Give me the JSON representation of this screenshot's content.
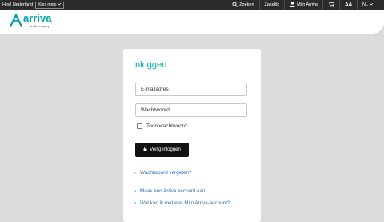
{
  "topbar": {
    "region_label": "Heel Nederland",
    "region_button": "Kies regio",
    "search_label": "Zoeken",
    "business_label": "Zakelijk",
    "account_label": "Mijn Arriva",
    "text_size_label": "AA",
    "language_label": "NL"
  },
  "header": {
    "logo_text": "arriva",
    "logo_sub": "a DB company"
  },
  "login": {
    "title": "Inloggen",
    "email_placeholder": "E-mailadres",
    "password_placeholder": "Wachtwoord",
    "show_password_label": "Toon wachtwoord",
    "submit_label": "Veilig inloggen",
    "forgot_password": "Wachtwoord vergeten?",
    "create_account": "Maak een Arriva account aan",
    "what_can_i_do": "Wat kan ik met een Mijn Arriva-account?"
  },
  "colors": {
    "brand": "#00a4a7",
    "link": "#2f6fb0",
    "topbar": "#2b2b2b",
    "button": "#111111"
  },
  "icons": [
    "chevron-down-icon",
    "search-icon",
    "user-icon",
    "cart-icon",
    "lock-icon",
    "chevron-right-icon",
    "arriva-logo-icon"
  ]
}
